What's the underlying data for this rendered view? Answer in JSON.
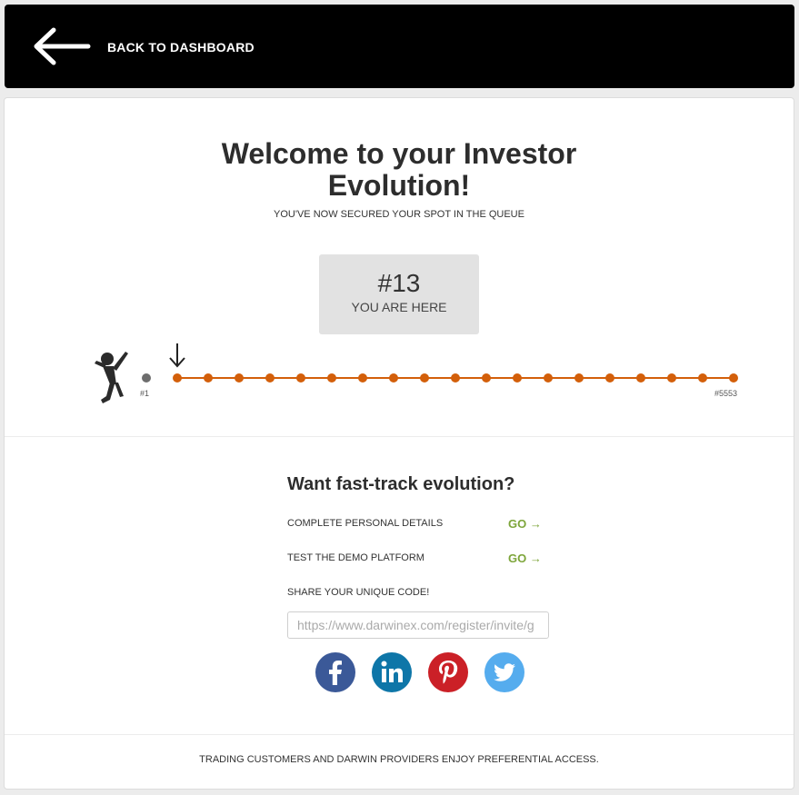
{
  "header": {
    "back_label": "BACK TO DASHBOARD",
    "back_icon": "arrow-left-icon"
  },
  "hero": {
    "title_line1": "Welcome to your Investor",
    "title_line2": "Evolution!",
    "subtitle": "YOU'VE NOW SECURED YOUR SPOT IN THE QUEUE"
  },
  "rank": {
    "number": "#13",
    "label": "YOU ARE HERE"
  },
  "queue": {
    "first_label": "#1",
    "last_label": "#5553",
    "dot_count": 19,
    "marker_index": 0,
    "track_color": "#d35f0a",
    "head_dot_color": "#6d6d6d",
    "figure_icon": "jumping-person-icon",
    "marker_icon": "arrow-down-icon"
  },
  "fast_track": {
    "title": "Want fast-track evolution?",
    "tasks": [
      {
        "label": "COMPLETE PERSONAL DETAILS",
        "action": "GO →"
      },
      {
        "label": "TEST THE DEMO PLATFORM",
        "action": "GO →"
      }
    ],
    "share_label": "SHARE YOUR UNIQUE CODE!",
    "share_value": "https://www.darwinex.com/register/invite/g"
  },
  "social": [
    {
      "name": "facebook",
      "icon": "facebook-icon",
      "color": "#3b5998"
    },
    {
      "name": "linkedin",
      "icon": "linkedin-icon",
      "color": "#0e76a8"
    },
    {
      "name": "pinterest",
      "icon": "pinterest-icon",
      "color": "#cb2027"
    },
    {
      "name": "twitter",
      "icon": "twitter-icon",
      "color": "#55acee"
    }
  ],
  "footer": {
    "text": "TRADING CUSTOMERS AND DARWIN PROVIDERS ENJOY PREFERENTIAL ACCESS."
  },
  "colors": {
    "accent_go": "#7da53a",
    "topbar": "#000000"
  }
}
